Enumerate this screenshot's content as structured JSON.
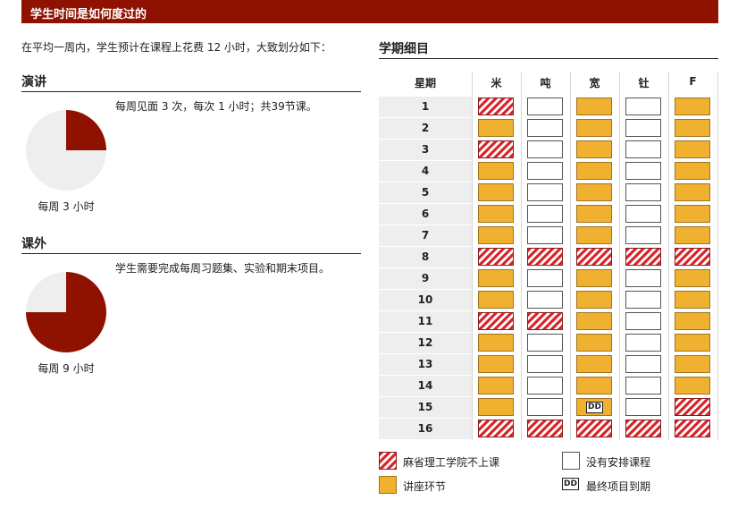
{
  "banner": {
    "title": "学生时间是如何度过的"
  },
  "intro": "在平均一周内，学生预计在课程上花费 12 小时，大致划分如下：",
  "lectures": {
    "title": "演讲",
    "description": "每周见面 3 次，每次 1 小时；共39节课。",
    "caption": "每周 3 小时",
    "hours": 3,
    "total_hours": 12
  },
  "outside": {
    "title": "课外",
    "description": "学生需要完成每周习题集、实验和期末项目。",
    "caption": "每周 9 小时",
    "hours": 9,
    "total_hours": 12
  },
  "colors": {
    "brand": "#8f1100",
    "pie_fill": "#8f1100",
    "pie_bg": "#eeeeee",
    "lecture": "#f0b030",
    "no_mit": "#d8262c"
  },
  "schedule": {
    "title": "学期细目",
    "header_week": "星期",
    "days": [
      "米",
      "吨",
      "宽",
      "钍",
      "F"
    ],
    "weeks": [
      {
        "week": "1",
        "cells": [
          "nomit",
          "none",
          "lec",
          "none",
          "lec"
        ]
      },
      {
        "week": "2",
        "cells": [
          "lec",
          "none",
          "lec",
          "none",
          "lec"
        ]
      },
      {
        "week": "3",
        "cells": [
          "nomit",
          "none",
          "lec",
          "none",
          "lec"
        ]
      },
      {
        "week": "4",
        "cells": [
          "lec",
          "none",
          "lec",
          "none",
          "lec"
        ]
      },
      {
        "week": "5",
        "cells": [
          "lec",
          "none",
          "lec",
          "none",
          "lec"
        ]
      },
      {
        "week": "6",
        "cells": [
          "lec",
          "none",
          "lec",
          "none",
          "lec"
        ]
      },
      {
        "week": "7",
        "cells": [
          "lec",
          "none",
          "lec",
          "none",
          "lec"
        ]
      },
      {
        "week": "8",
        "cells": [
          "nomit",
          "nomit",
          "nomit",
          "nomit",
          "nomit"
        ]
      },
      {
        "week": "9",
        "cells": [
          "lec",
          "none",
          "lec",
          "none",
          "lec"
        ]
      },
      {
        "week": "10",
        "cells": [
          "lec",
          "none",
          "lec",
          "none",
          "lec"
        ]
      },
      {
        "week": "11",
        "cells": [
          "nomit",
          "nomit",
          "lec",
          "none",
          "lec"
        ]
      },
      {
        "week": "12",
        "cells": [
          "lec",
          "none",
          "lec",
          "none",
          "lec"
        ]
      },
      {
        "week": "13",
        "cells": [
          "lec",
          "none",
          "lec",
          "none",
          "lec"
        ]
      },
      {
        "week": "14",
        "cells": [
          "lec",
          "none",
          "lec",
          "none",
          "lec"
        ]
      },
      {
        "week": "15",
        "cells": [
          "lec",
          "none",
          "dd",
          "none",
          "nomit"
        ]
      },
      {
        "week": "16",
        "cells": [
          "nomit",
          "nomit",
          "nomit",
          "nomit",
          "nomit"
        ]
      }
    ],
    "dd_label": "DD"
  },
  "legend": {
    "no_mit": "麻省理工学院不上课",
    "none": "没有安排课程",
    "lecture": "讲座环节",
    "dd": "最终项目到期",
    "dd_mark": "DD"
  }
}
